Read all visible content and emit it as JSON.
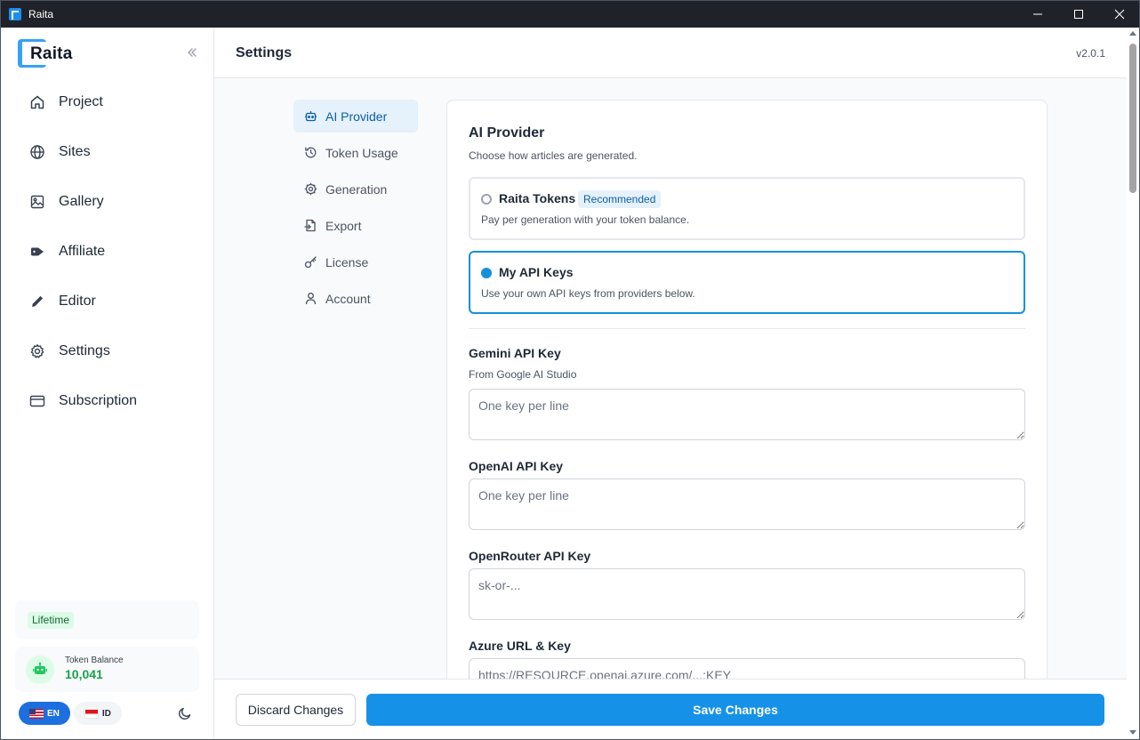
{
  "window": {
    "title": "Raita",
    "controls": [
      "minimize-icon",
      "maximize-icon",
      "close-icon"
    ]
  },
  "sidebar": {
    "logo_text": "Raita",
    "collapse_icon": "chevrons-left-icon",
    "items": [
      {
        "label": "Project",
        "icon": "home-icon"
      },
      {
        "label": "Sites",
        "icon": "globe-icon"
      },
      {
        "label": "Gallery",
        "icon": "image-icon"
      },
      {
        "label": "Affiliate",
        "icon": "tag-icon"
      },
      {
        "label": "Editor",
        "icon": "pencil-icon"
      },
      {
        "label": "Settings",
        "icon": "gear-icon"
      },
      {
        "label": "Subscription",
        "icon": "credit-card-icon"
      }
    ],
    "plan_badge": "Lifetime",
    "token_balance": {
      "label": "Token Balance",
      "value": "10,041"
    },
    "languages": [
      {
        "code": "EN",
        "flag": "us-flag",
        "active": true
      },
      {
        "code": "ID",
        "flag": "id-flag",
        "active": false
      }
    ],
    "theme_toggle_icon": "moon-icon"
  },
  "header": {
    "title": "Settings",
    "version": "v2.0.1"
  },
  "settings_nav": {
    "items": [
      {
        "label": "AI Provider",
        "icon": "robot-icon",
        "active": true
      },
      {
        "label": "Token Usage",
        "icon": "history-icon",
        "active": false
      },
      {
        "label": "Generation",
        "icon": "cog-icon",
        "active": false
      },
      {
        "label": "Export",
        "icon": "export-icon",
        "active": false
      },
      {
        "label": "License",
        "icon": "key-icon",
        "active": false
      },
      {
        "label": "Account",
        "icon": "user-icon",
        "active": false
      }
    ]
  },
  "ai_provider": {
    "title": "AI Provider",
    "subtitle": "Choose how articles are generated.",
    "options": [
      {
        "title": "Raita Tokens",
        "badge": "Recommended",
        "description": "Pay per generation with your token balance.",
        "selected": false
      },
      {
        "title": "My API Keys",
        "badge": "",
        "description": "Use your own API keys from providers below.",
        "selected": true
      }
    ],
    "fields": [
      {
        "label": "Gemini API Key",
        "hint": "From Google AI Studio",
        "placeholder": "One key per line",
        "value": ""
      },
      {
        "label": "OpenAI API Key",
        "hint": "",
        "placeholder": "One key per line",
        "value": ""
      },
      {
        "label": "OpenRouter API Key",
        "hint": "",
        "placeholder": "sk-or-...",
        "value": ""
      },
      {
        "label": "Azure URL & Key",
        "hint": "",
        "placeholder": "https://RESOURCE.openai.azure.com/...:KEY",
        "value": ""
      }
    ]
  },
  "footer": {
    "discard_label": "Discard Changes",
    "save_label": "Save Changes"
  },
  "colors": {
    "accent": "#1591e8",
    "accent_dark": "#0c5fa8",
    "accent_light": "#e5f1fb",
    "success": "#16a34a",
    "titlebar": "#1f2329"
  }
}
